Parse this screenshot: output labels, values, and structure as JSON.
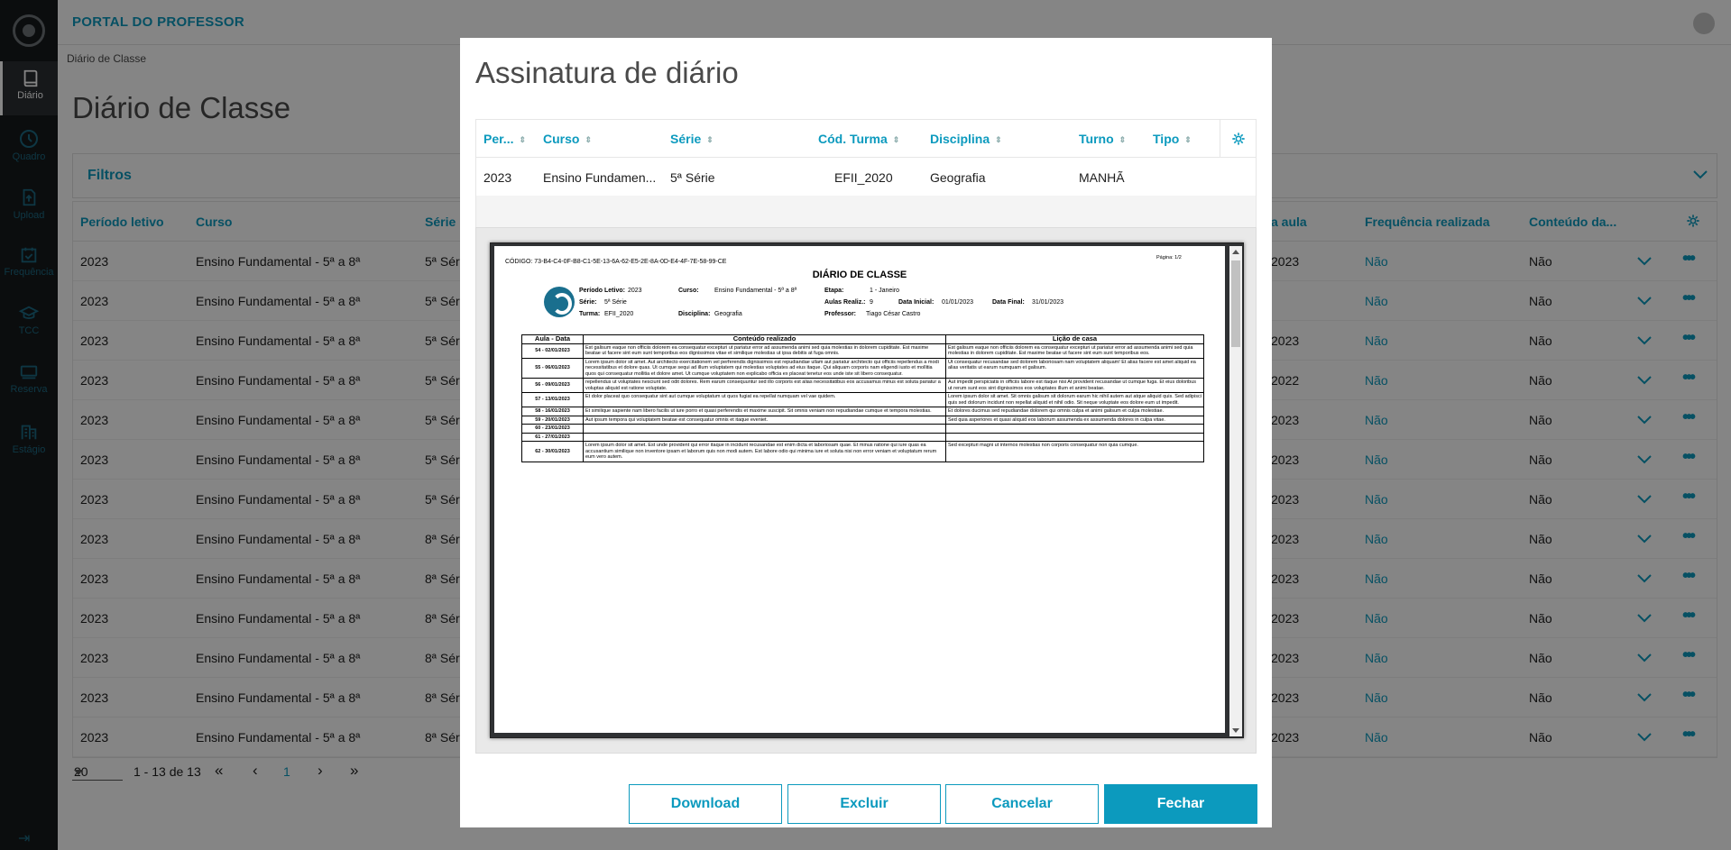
{
  "app": {
    "portal_title": "PORTAL DO PROFESSOR"
  },
  "sidebar": {
    "items": [
      {
        "label": "Diário",
        "icon": "book-icon",
        "active": true
      },
      {
        "label": "Quadro",
        "icon": "clock-icon"
      },
      {
        "label": "Upload",
        "icon": "upload-icon"
      },
      {
        "label": "Frequência",
        "icon": "calendar-check-icon"
      },
      {
        "label": "TCC",
        "icon": "graduation-cap-icon"
      },
      {
        "label": "Reserva",
        "icon": "monitor-icon"
      },
      {
        "label": "Estágio",
        "icon": "building-icon"
      }
    ]
  },
  "breadcrumb": "Diário de Classe",
  "page_title": "Diário de Classe",
  "filters": {
    "label": "Filtros"
  },
  "grid": {
    "headers": {
      "periodo": "Período letivo",
      "curso": "Curso",
      "serie": "Série",
      "aula": "a aula",
      "frequencia": "Frequência realizada",
      "conteudo": "Conteúdo da..."
    },
    "rows": [
      {
        "periodo": "2023",
        "curso": "Ensino Fundamental - 5ª a 8ª",
        "serie": "5ª Séri",
        "aula": "2023",
        "freq": "Não",
        "conteudo": "Não"
      },
      {
        "periodo": "2023",
        "curso": "Ensino Fundamental - 5ª a 8ª",
        "serie": "5ª Séri",
        "aula": "",
        "freq": "Não",
        "conteudo": "Não"
      },
      {
        "periodo": "2023",
        "curso": "Ensino Fundamental - 5ª a 8ª",
        "serie": "5ª Séri",
        "aula": "2023",
        "freq": "Não",
        "conteudo": "Não"
      },
      {
        "periodo": "2023",
        "curso": "Ensino Fundamental - 5ª a 8ª",
        "serie": "5ª Séri",
        "aula": "2022",
        "freq": "Não",
        "conteudo": "Não"
      },
      {
        "periodo": "2023",
        "curso": "Ensino Fundamental - 5ª a 8ª",
        "serie": "5ª Séri",
        "aula": "2023",
        "freq": "Não",
        "conteudo": "Não"
      },
      {
        "periodo": "2023",
        "curso": "Ensino Fundamental - 5ª a 8ª",
        "serie": "5ª Séri",
        "aula": "2023",
        "freq": "Não",
        "conteudo": "Não"
      },
      {
        "periodo": "2023",
        "curso": "Ensino Fundamental - 5ª a 8ª",
        "serie": "5ª Séri",
        "aula": "2023",
        "freq": "Não",
        "conteudo": "Não"
      },
      {
        "periodo": "2023",
        "curso": "Ensino Fundamental - 5ª a 8ª",
        "serie": "8ª Séri",
        "aula": "2023",
        "freq": "Não",
        "conteudo": "Não"
      },
      {
        "periodo": "2023",
        "curso": "Ensino Fundamental - 5ª a 8ª",
        "serie": "8ª Séri",
        "aula": "2023",
        "freq": "Não",
        "conteudo": "Não"
      },
      {
        "periodo": "2023",
        "curso": "Ensino Fundamental - 5ª a 8ª",
        "serie": "8ª Séri",
        "aula": "2023",
        "freq": "Não",
        "conteudo": "Não"
      },
      {
        "periodo": "2023",
        "curso": "Ensino Fundamental - 5ª a 8ª",
        "serie": "8ª Séri",
        "aula": "2023",
        "freq": "Não",
        "conteudo": "Não"
      },
      {
        "periodo": "2023",
        "curso": "Ensino Fundamental - 5ª a 8ª",
        "serie": "8ª Séri",
        "aula": "2023",
        "freq": "Não",
        "conteudo": "Não"
      },
      {
        "periodo": "2023",
        "curso": "Ensino Fundamental - 5ª a 8ª",
        "serie": "8ª Séri",
        "aula": "2023",
        "freq": "Não",
        "conteudo": "Não"
      }
    ]
  },
  "pager": {
    "page_size": "20",
    "range": "1 - 13 de 13",
    "first": "«",
    "prev": "‹",
    "current": "1",
    "next": "›",
    "last": "»"
  },
  "modal": {
    "title": "Assinatura de diário",
    "headers": [
      "Per...",
      "Curso",
      "Série",
      "Cód. Turma",
      "Disciplina",
      "Turno",
      "Tipo"
    ],
    "row": {
      "periodo": "2023",
      "curso": "Ensino Fundamen...",
      "serie": "5ª Série",
      "turma": "EFII_2020",
      "disciplina": "Geografia",
      "turno": "MANHÃ",
      "tipo": ""
    },
    "buttons": {
      "download": "Download",
      "excluir": "Excluir",
      "cancelar": "Cancelar",
      "fechar": "Fechar"
    }
  },
  "pdf": {
    "codigo": "CÓDIGO: 73-B4-C4-0F-B8-C1-5E-13-6A-62-E5-2E-8A-0D-E4-4F-7E-58-99-CE",
    "pagina": "Página: 1/2",
    "title": "DIÁRIO DE CLASSE",
    "fields": {
      "periodo_label": "Período Letivo:",
      "periodo": "2023",
      "curso_label": "Curso:",
      "curso": "Ensino Fundamental - 5ª a 8ª",
      "etapa_label": "Etapa:",
      "etapa": "1 - Janeiro",
      "serie_label": "Série:",
      "serie": "5ª Série",
      "aulas_label": "Aulas Realiz.:",
      "aulas": "9",
      "data_inicial_label": "Data Inicial:",
      "data_inicial": "01/01/2023",
      "data_final_label": "Data Final:",
      "data_final": "31/01/2023",
      "turma_label": "Turma:",
      "turma": "EFII_2020",
      "disciplina_label": "Disciplina:",
      "disciplina": "Geografia",
      "professor_label": "Professor:",
      "professor": "Tiago César Castro"
    },
    "table_headers": [
      "Aula - Data",
      "Conteúdo realizado",
      "Lição de casa"
    ],
    "rows": [
      {
        "data": "54 - 02/01/2023",
        "conteudo": "Est galisum eaque non officiis dolorem ea consequatur excepturi ut pariatur error ad assumenda animi sed quia molestias in dolorem cupiditate. Est maxime beatae ut facere sint eum sunt temporibus eos dignissimos vitae et similique molestias ut ipsa debitis at fuga omnis.",
        "licao": "Est galisum eaque non officiis dolorem ea consequatur excepturi ut pariatur error ad assumenda animi sed quia molestias in dolorem cupiditate. Est maxime beatae ut facere sint eum sunt temporibus eos."
      },
      {
        "data": "55 - 06/01/2023",
        "conteudo": "Lorem ipsum dolor sit amet. Aut architecto exercitationem vel perferendis dignissimos est repudiandae ullam aut pariatur architecto qui officiis repellendus a modi necessitatibus et dolore quas. Ut cumque sequi ad illum voluptatem qui molestias voluptates ad eius itaque. Qui aliquam corporis nam eligendi iusto et mollitia quos qui consequatur mollitia et dolore amet. Ut cumque voluptatem non explicabo officia ex placeat tenetur eos unde iste sit libero consequatur.",
        "licao": "Ut consequatur recusandae sed dolorem laboriosam nam voluptatem aliquam! Et alias facere est amet aliquid ea alias veritatis ut earum numquam et galisum."
      },
      {
        "data": "56 - 09/01/2023",
        "conteudo": "repellendus ut voluptates nesciunt sed odit dolores. Rem earum consequuntur sed illo corporis est alias necessitatibus eos accusamus minus est soluta pariatur a voluptas aliquid est ratione voluptate.",
        "licao": "Aut impedit perspiciatis in officiis labore est itaque nisi At provident recusandae ut cumque fuga. Et eius doloribus ut rerum sunt eos sint dignissimos eos voluptates illum et animi beatae."
      },
      {
        "data": "57 - 13/01/2023",
        "conteudo": "Et dolor placeat quo consequatur sint aut cumque voluptatum ut quos fugiat ea repellat numquam vel vae quidem.",
        "licao": "Lorem ipsum dolor sit amet. Sit omnis galisum sit dolorum earum hic nihil autem aut atque aliquid quis. Sed adipisci quis sed dolorum incidunt non repellat aliquid et nihil odio. Sit neque voluptate eos dolore eum ut impedit."
      },
      {
        "data": "58 - 16/01/2023",
        "conteudo": "Et similique sapiente nam libero facilis ut iure porro et quasi perferendis et maxime suscipit. Sit omnis veniam non repudiandae cumque et tempora molestias.",
        "licao": "Et dolores ducimus sed repudiandae dolorem qui omnis culpa et animi galisum et culpa molestiae."
      },
      {
        "data": "59 - 20/01/2023",
        "conteudo": "Aut ipsum tempora qui voluptatem beatae est consequatur omnis et itaque eveniet.",
        "licao": "Sed quia asperiores et quasi aliquid eos laborum assumenda ex assumenda dolores in culpa vitae."
      },
      {
        "data": "60 - 23/01/2023",
        "conteudo": "",
        "licao": ""
      },
      {
        "data": "61 - 27/01/2023",
        "conteudo": "",
        "licao": ""
      },
      {
        "data": "62 - 30/01/2023",
        "conteudo": "Lorem ipsum dolor sit amet. Est unde provident qui error itaque in incidunt recusandae est enim dicta et laboriosam quae. Et minus ratione qui iure quas ea accusantium similique non inventore ipsam et laborum quis non modi autem. Est labore odio qui minima iure et soluta nisi non error veniam et voluptatum rerum eum vero autem.",
        "licao": "Sed excepturi magni ut internos molestias non corporis consequatur non quia cumque."
      }
    ]
  },
  "colors": {
    "accent": "#0c9abe",
    "sidebar": "#16191c",
    "overlay": "rgba(0,0,0,0.48)"
  }
}
